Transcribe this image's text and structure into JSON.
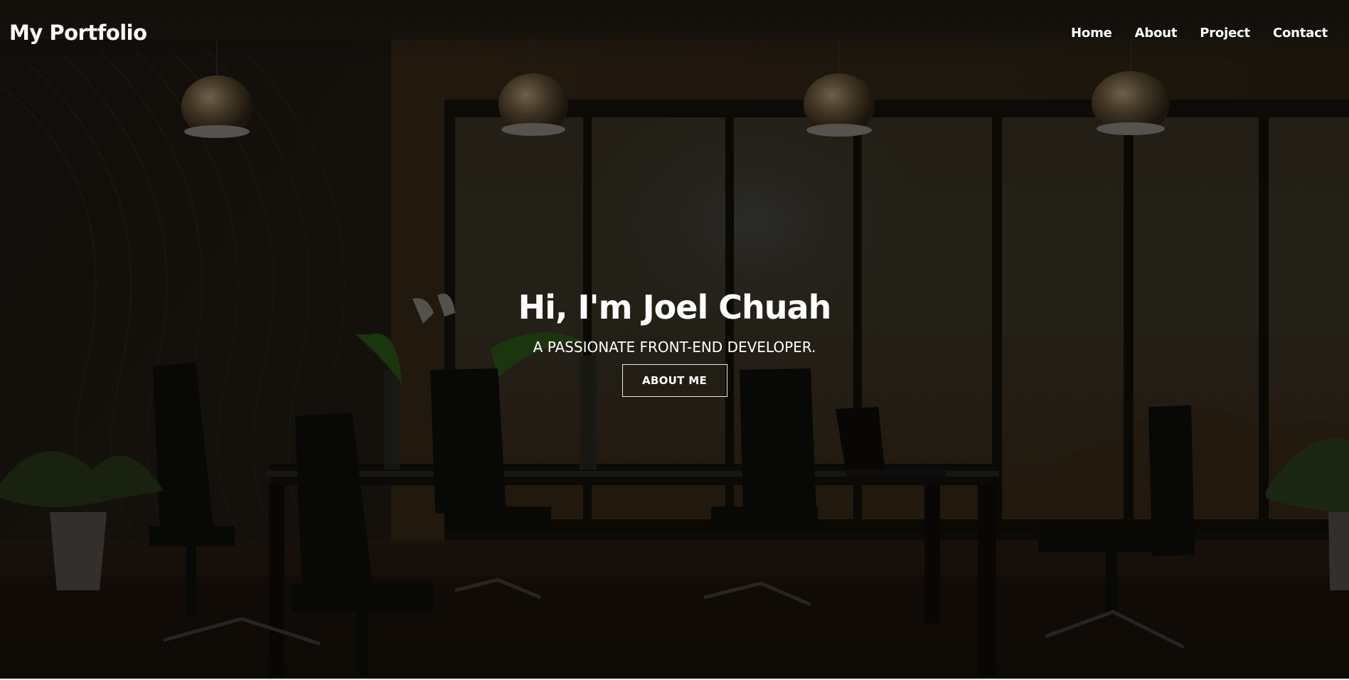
{
  "header": {
    "brand": "My Portfolio",
    "nav": [
      {
        "label": "Home"
      },
      {
        "label": "About"
      },
      {
        "label": "Project"
      },
      {
        "label": "Contact"
      }
    ]
  },
  "hero": {
    "title": "Hi, I'm Joel Chuah",
    "subtitle": "A PASSIONATE FRONT-END DEVELOPER.",
    "button_label": "ABOUT ME",
    "background_description_icon": "conference-room-photo"
  },
  "colors": {
    "text": "#ffffff",
    "background_dark": "#14110d",
    "button_border": "#e8e8e8"
  }
}
